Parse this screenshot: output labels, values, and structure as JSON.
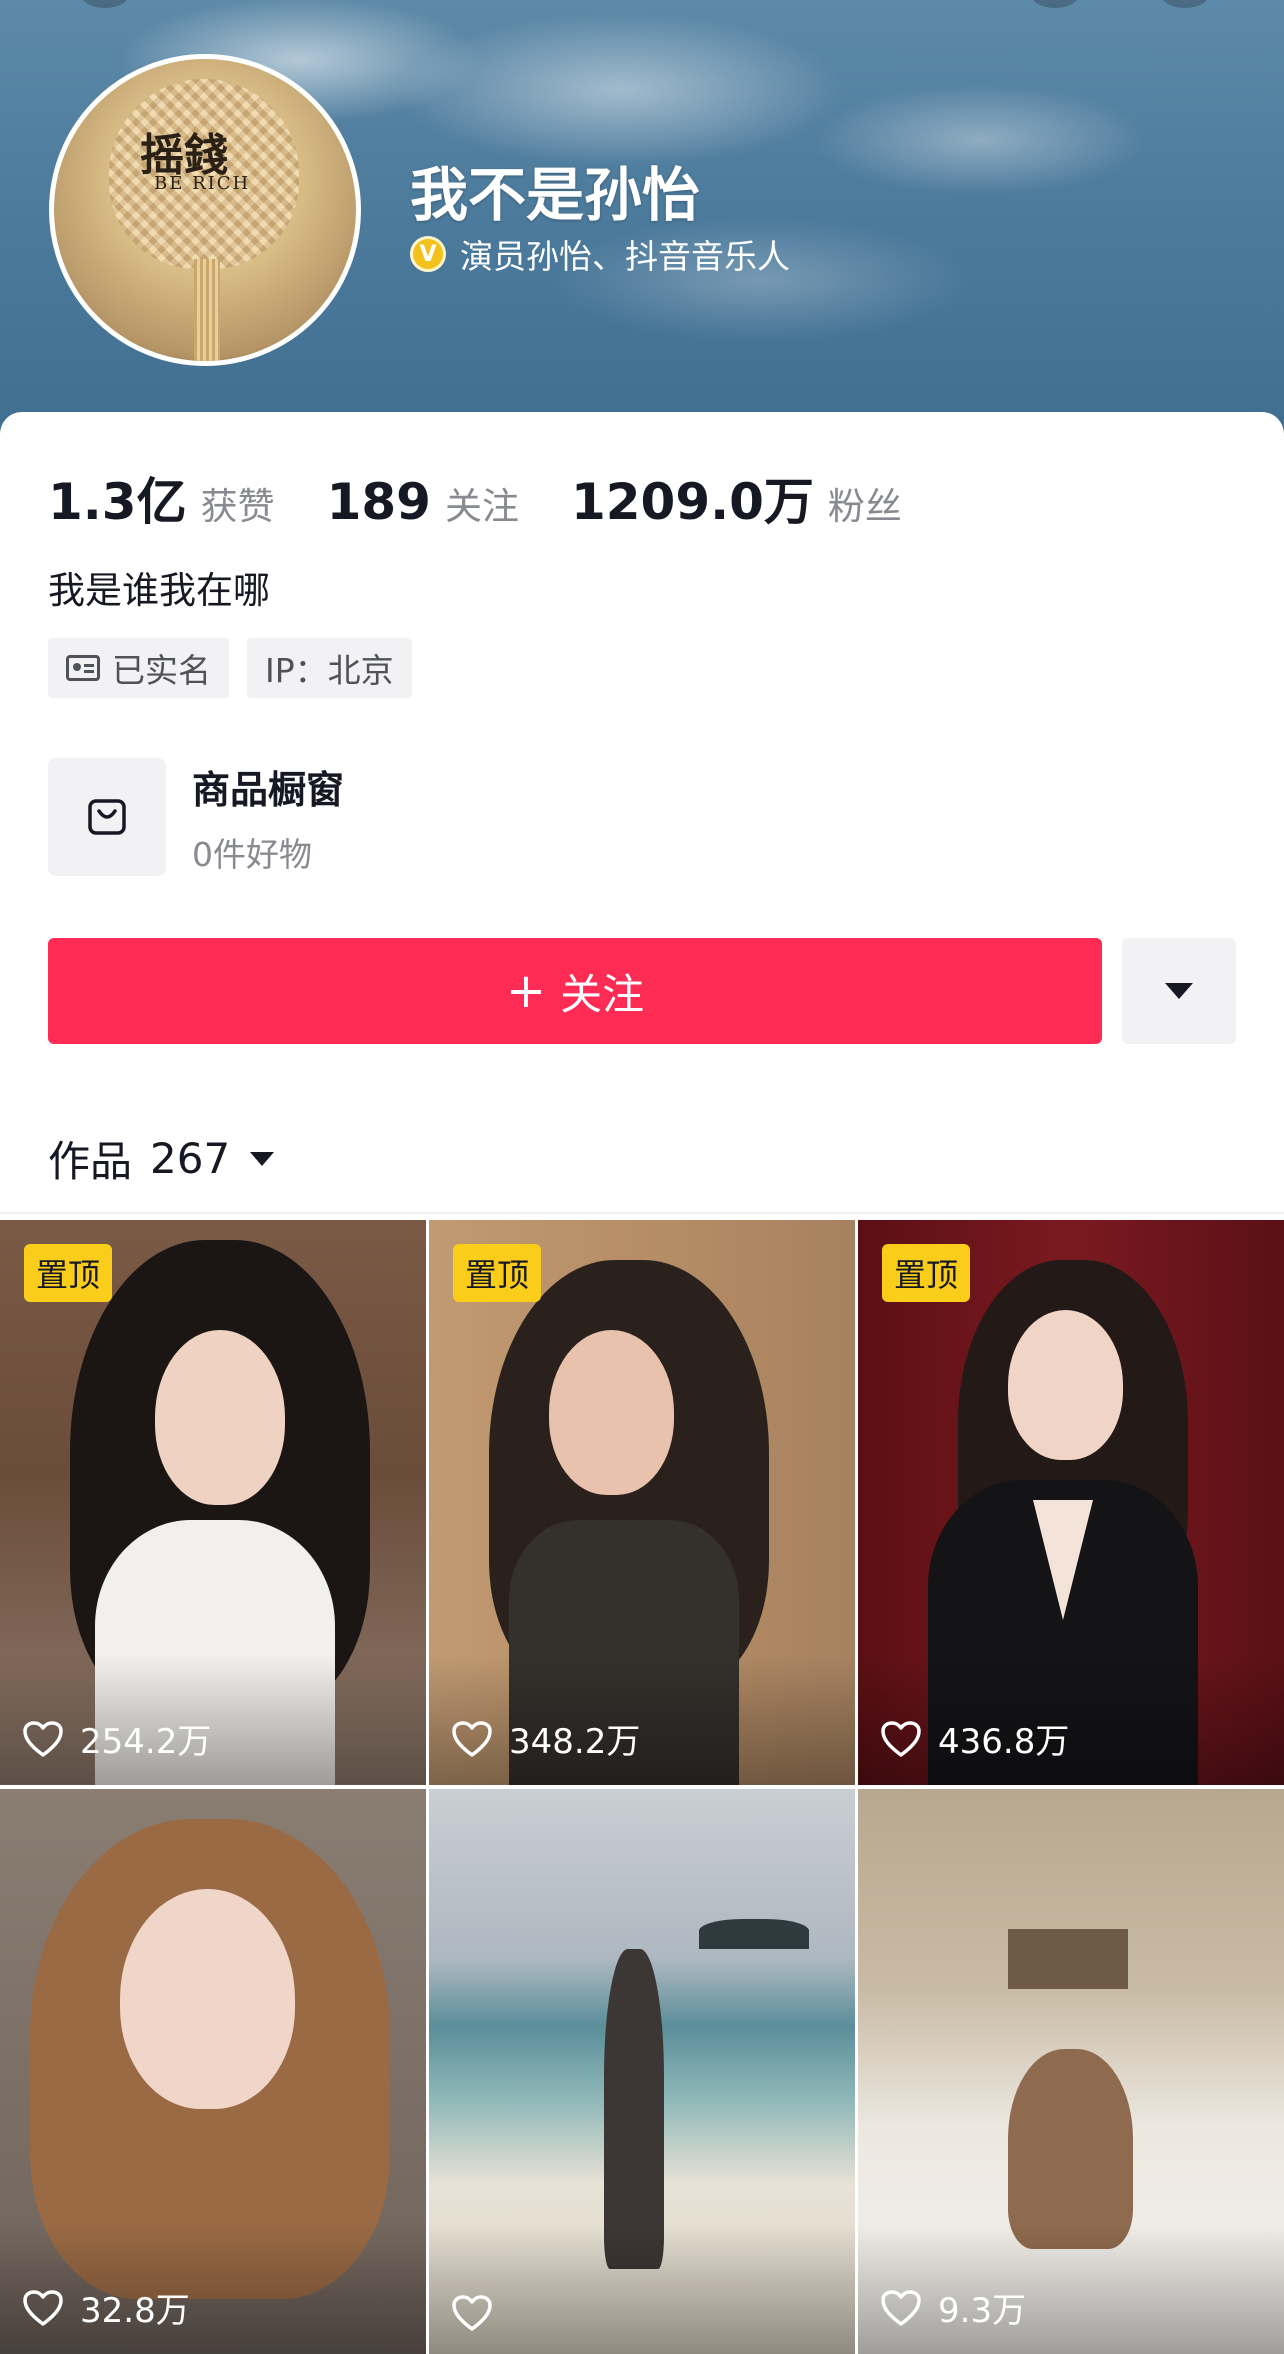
{
  "profile": {
    "nickname": "我不是孙怡",
    "verification": "演员孙怡、抖音音乐人",
    "verification_badge": "V",
    "avatar_text_line1": "摇錢",
    "avatar_text_line2": "BE RICH",
    "bio": "我是谁我在哪"
  },
  "stats": [
    {
      "value": "1.3亿",
      "label": "获赞"
    },
    {
      "value": "189",
      "label": "关注"
    },
    {
      "value": "1209.0万",
      "label": "粉丝"
    }
  ],
  "tags": {
    "real_name": "已实名",
    "ip": "IP：北京"
  },
  "shop": {
    "title": "商品橱窗",
    "subtitle": "0件好物"
  },
  "actions": {
    "follow_plus": "+",
    "follow_label": "关注"
  },
  "works": {
    "label": "作品",
    "count": "267"
  },
  "videos": [
    {
      "pinned": true,
      "pin_label": "置顶",
      "likes": "254.2万"
    },
    {
      "pinned": true,
      "pin_label": "置顶",
      "likes": "348.2万"
    },
    {
      "pinned": true,
      "pin_label": "置顶",
      "likes": "436.8万"
    },
    {
      "pinned": false,
      "likes": "32.8万"
    },
    {
      "pinned": false,
      "likes": ""
    },
    {
      "pinned": false,
      "likes": "9.3万"
    }
  ],
  "colors": {
    "accent": "#fe2c55",
    "pin_badge": "#facd1a",
    "verify_badge": "#f3c11b"
  }
}
